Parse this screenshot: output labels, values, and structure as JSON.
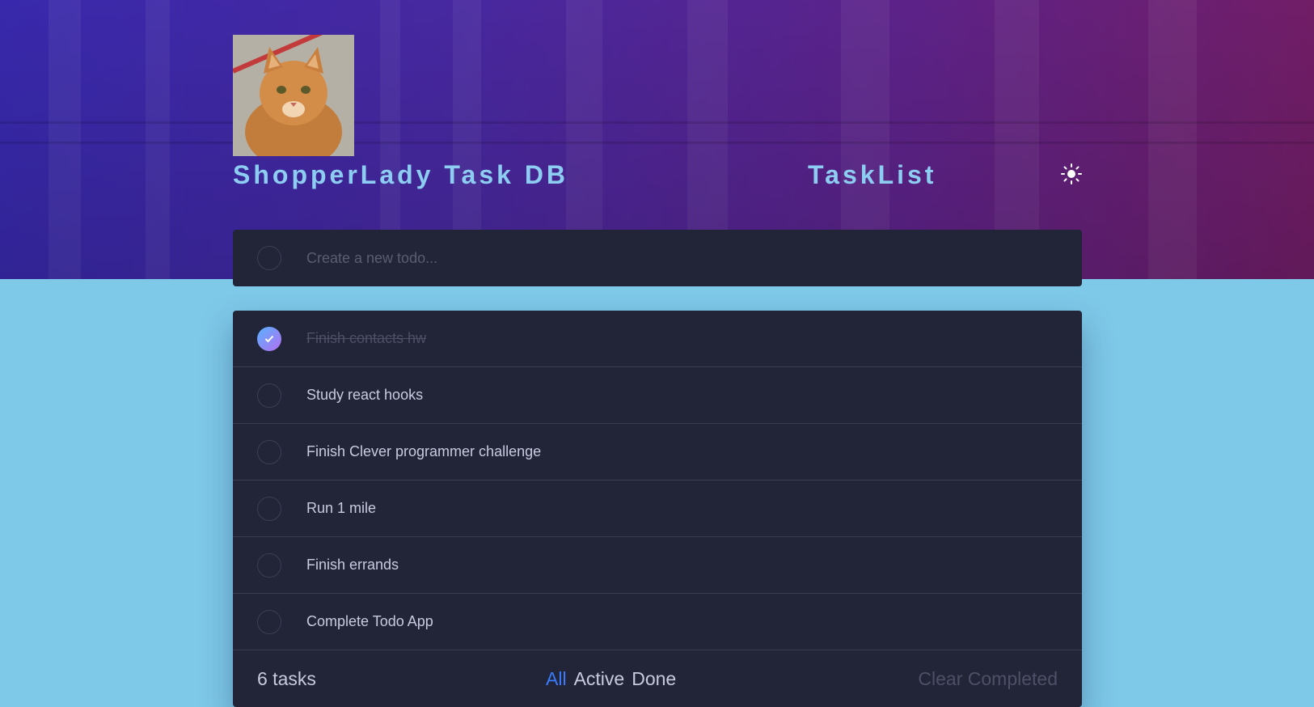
{
  "header": {
    "brand": "ShopperLady Task DB",
    "list_title": "TaskList",
    "theme_toggle_icon": "sun-icon"
  },
  "new_todo": {
    "placeholder": "Create a new todo..."
  },
  "todos": [
    {
      "label": "Finish contacts hw",
      "completed": true
    },
    {
      "label": "Study react hooks",
      "completed": false
    },
    {
      "label": "Finish Clever programmer challenge",
      "completed": false
    },
    {
      "label": "Run 1 mile",
      "completed": false
    },
    {
      "label": "Finish errands",
      "completed": false
    },
    {
      "label": "Complete Todo App",
      "completed": false
    }
  ],
  "footer": {
    "count_label": "6 tasks",
    "filters": [
      "All",
      "Active",
      "Done"
    ],
    "active_filter": "All",
    "clear_label": "Clear Completed"
  },
  "colors": {
    "accent": "#3a7bfd",
    "page_bg": "#7ec8e8",
    "card_bg": "#222537",
    "title": "#8ecdf2"
  }
}
